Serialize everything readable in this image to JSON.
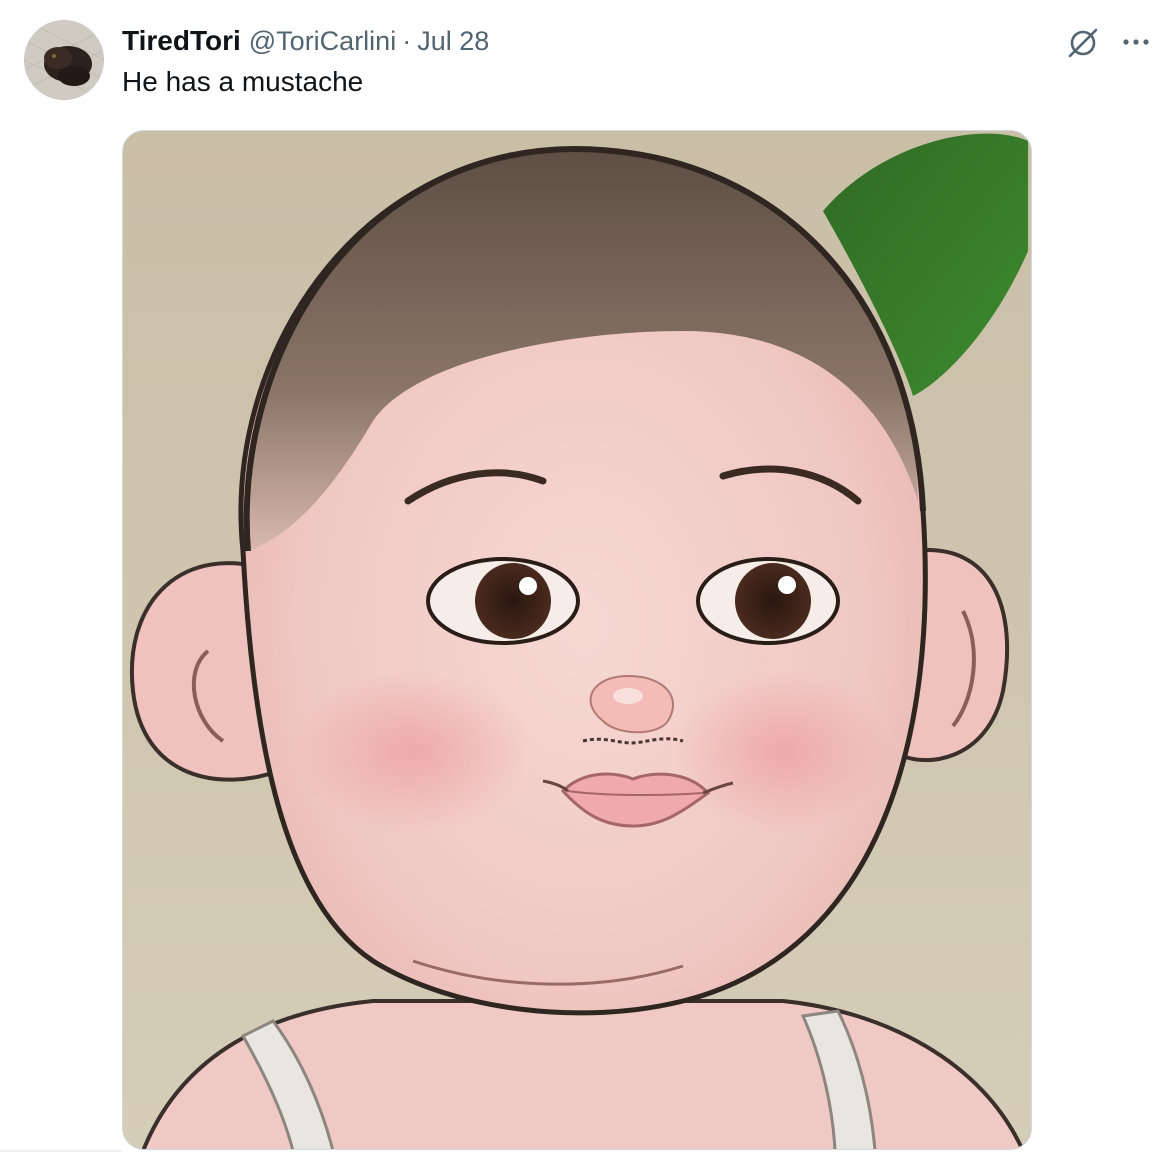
{
  "tweet": {
    "display_name": "TiredTori",
    "handle": "@ToriCarlini",
    "separator": "·",
    "date": "Jul 28",
    "text": "He has a mustache"
  },
  "icons": {
    "avatar": "avatar-cat-photo",
    "grok": "grok-icon",
    "more": "more-icon"
  },
  "media": {
    "type": "illustration",
    "subject": "cartoon-baby-face"
  },
  "colors": {
    "text_primary": "#0f1419",
    "text_secondary": "#536471",
    "border": "#cfd9de"
  }
}
